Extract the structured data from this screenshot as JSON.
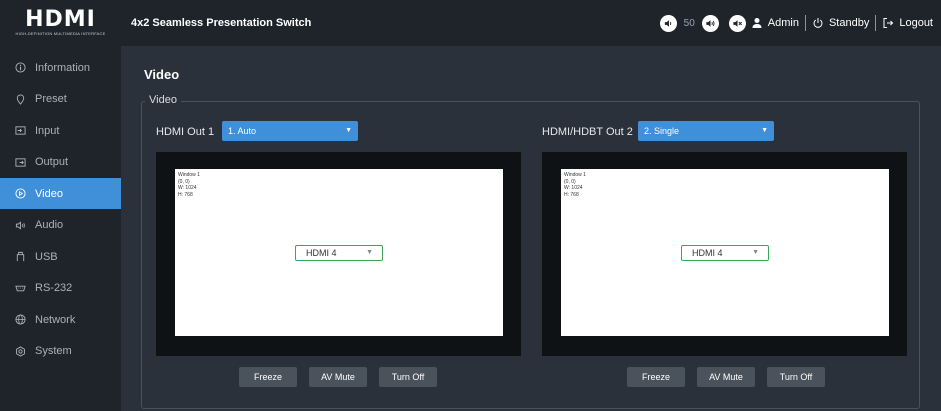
{
  "logo": {
    "main": "HDMI",
    "sub": "HIGH-DEFINITION MULTIMEDIA INTERFACE"
  },
  "header": {
    "title": "4x2 Seamless Presentation Switch",
    "volume_value": "50",
    "user": "Admin",
    "standby_label": "Standby",
    "logout_label": "Logout"
  },
  "sidebar": {
    "items": [
      {
        "label": "Information",
        "icon": "info-icon"
      },
      {
        "label": "Preset",
        "icon": "pin-icon"
      },
      {
        "label": "Input",
        "icon": "input-icon"
      },
      {
        "label": "Output",
        "icon": "output-icon"
      },
      {
        "label": "Video",
        "icon": "video-icon",
        "active": true
      },
      {
        "label": "Audio",
        "icon": "speaker-icon"
      },
      {
        "label": "USB",
        "icon": "usb-icon"
      },
      {
        "label": "RS-232",
        "icon": "serial-icon"
      },
      {
        "label": "Network",
        "icon": "globe-icon"
      },
      {
        "label": "System",
        "icon": "settings-icon"
      }
    ]
  },
  "main": {
    "page_title": "Video",
    "section_legend": "Video",
    "outputs": [
      {
        "label": "HDMI Out 1",
        "mode": "1. Auto",
        "window": {
          "name": "Window 1",
          "pos": "(0, 0)",
          "w": "W: 1024",
          "h": "H: 768"
        },
        "source": "HDMI 4",
        "buttons": {
          "freeze": "Freeze",
          "av_mute": "AV Mute",
          "turn_off": "Turn Off"
        }
      },
      {
        "label": "HDMI/HDBT Out 2",
        "mode": "2. Single",
        "window": {
          "name": "Window 1",
          "pos": "(0, 0)",
          "w": "W: 1024",
          "h": "H: 768"
        },
        "source": "HDMI 4",
        "buttons": {
          "freeze": "Freeze",
          "av_mute": "AV Mute",
          "turn_off": "Turn Off"
        }
      }
    ]
  },
  "colors": {
    "accent": "#3f8fd9",
    "sidebar_bg": "#1f242b",
    "content_bg": "#2b313a",
    "button_bg": "#4a525c"
  }
}
